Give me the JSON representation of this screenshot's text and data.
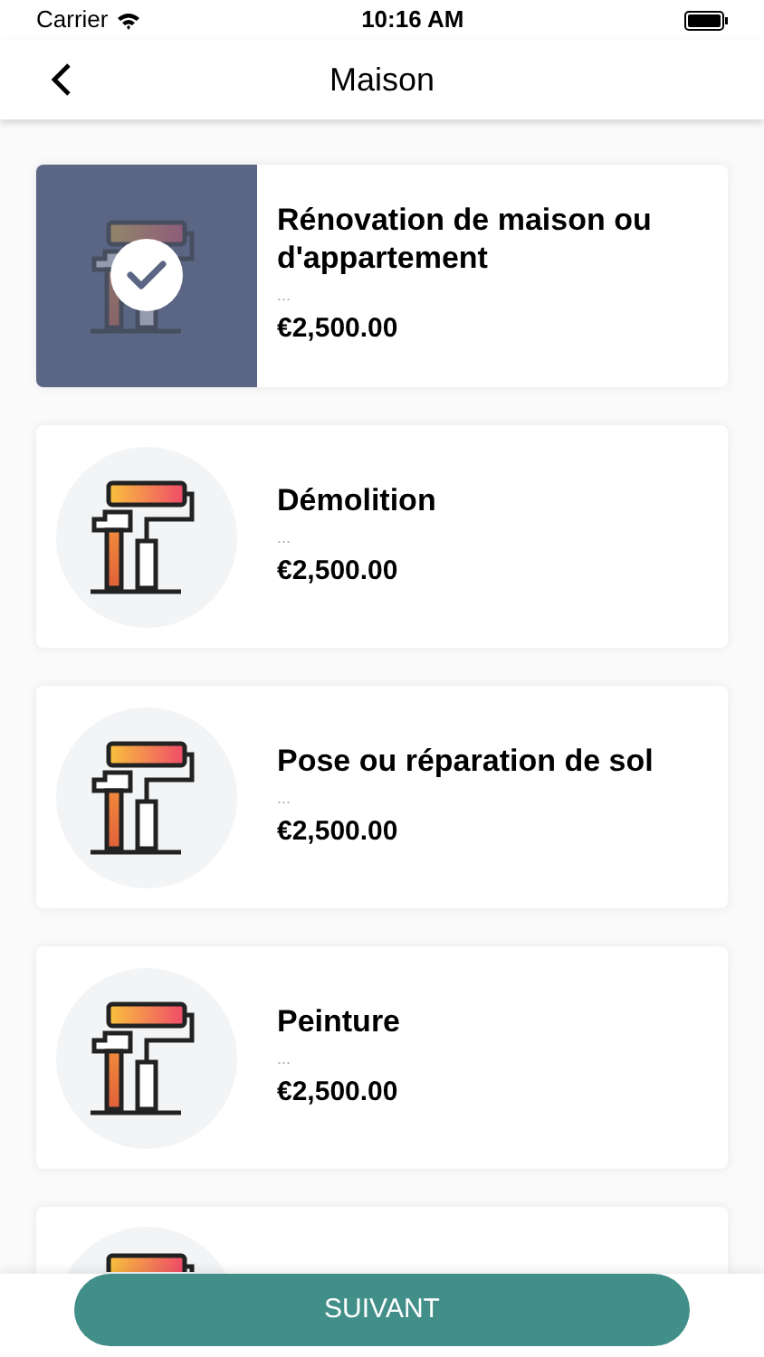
{
  "status_bar": {
    "carrier": "Carrier",
    "time": "10:16 AM"
  },
  "header": {
    "title": "Maison"
  },
  "services": [
    {
      "title": "Rénovation de maison ou d'appartement",
      "subtitle": "...",
      "price": "€2,500.00",
      "selected": true
    },
    {
      "title": "Démolition",
      "subtitle": "...",
      "price": "€2,500.00",
      "selected": false
    },
    {
      "title": "Pose ou réparation de sol",
      "subtitle": "...",
      "price": "€2,500.00",
      "selected": false
    },
    {
      "title": "Peinture",
      "subtitle": "...",
      "price": "€2,500.00",
      "selected": false
    },
    {
      "selected": false
    }
  ],
  "next_button": "SUIVANT"
}
